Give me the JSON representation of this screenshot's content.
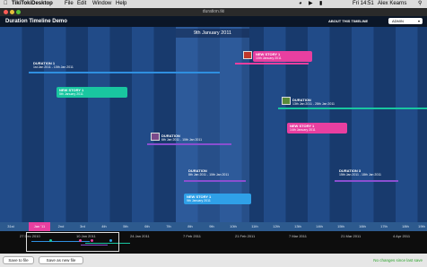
{
  "menubar": {
    "app": "TikiTokiDesktop",
    "menus": [
      "File",
      "Edit",
      "Window",
      "Help"
    ],
    "clock": "Fri 14:51",
    "user": "Alex Kearns"
  },
  "window": {
    "title": "duration.tki"
  },
  "header": {
    "title": "Duration Timeline Demo",
    "about": "ABOUT THIS TIMELINE",
    "mode": "ADMIN"
  },
  "timeline": {
    "current_date": "9th January 2011",
    "events": [
      {
        "title": "DURATION 1",
        "dates": "1st Jan 2011 - 10th Jan 2011"
      },
      {
        "title": "NEW STORY 1",
        "dates": "10th January 2011"
      },
      {
        "title": "NEW STORY 1",
        "dates": "5th January 2011"
      },
      {
        "title": "DURATION",
        "dates": "13th Jan 2011 - 28th Jan 2011"
      },
      {
        "title": "NEW STORY 1",
        "dates": "14th January 2011"
      },
      {
        "title": "DURATION",
        "dates": "6th Jan 2011 - 10th Jan 2011"
      },
      {
        "title": "DURATION",
        "dates": "8th Jan 2011 - 10th Jan 2011"
      },
      {
        "title": "DURATION 3",
        "dates": "15th Jan 2011 - 18th Jan 2011"
      },
      {
        "title": "NEW STORY 1",
        "dates": "9th January 2011"
      }
    ],
    "ticks": [
      "31st",
      "Jan '11",
      "2nd",
      "3rd",
      "4th",
      "5th",
      "6th",
      "7th",
      "8th",
      "9th",
      "10th",
      "11th",
      "12th",
      "13th",
      "14th",
      "15th",
      "16th",
      "17th",
      "18th",
      "19th"
    ]
  },
  "minimap": {
    "labels": [
      "27 Dec 2010",
      "10 Jan 2011",
      "24 Jan 2011",
      "7 Feb 2011",
      "21 Feb 2011",
      "7 Mar 2011",
      "21 Mar 2011",
      "4 Apr 2011",
      "18 Apr 2011"
    ]
  },
  "footer": {
    "save": "Save to file",
    "save_as": "Save as new file",
    "status": "No changes since last save"
  },
  "colors": {
    "blue": "#2f8fe0",
    "teal": "#19c6a0",
    "pink": "#e83fa0",
    "purple": "#8a4fd0"
  }
}
